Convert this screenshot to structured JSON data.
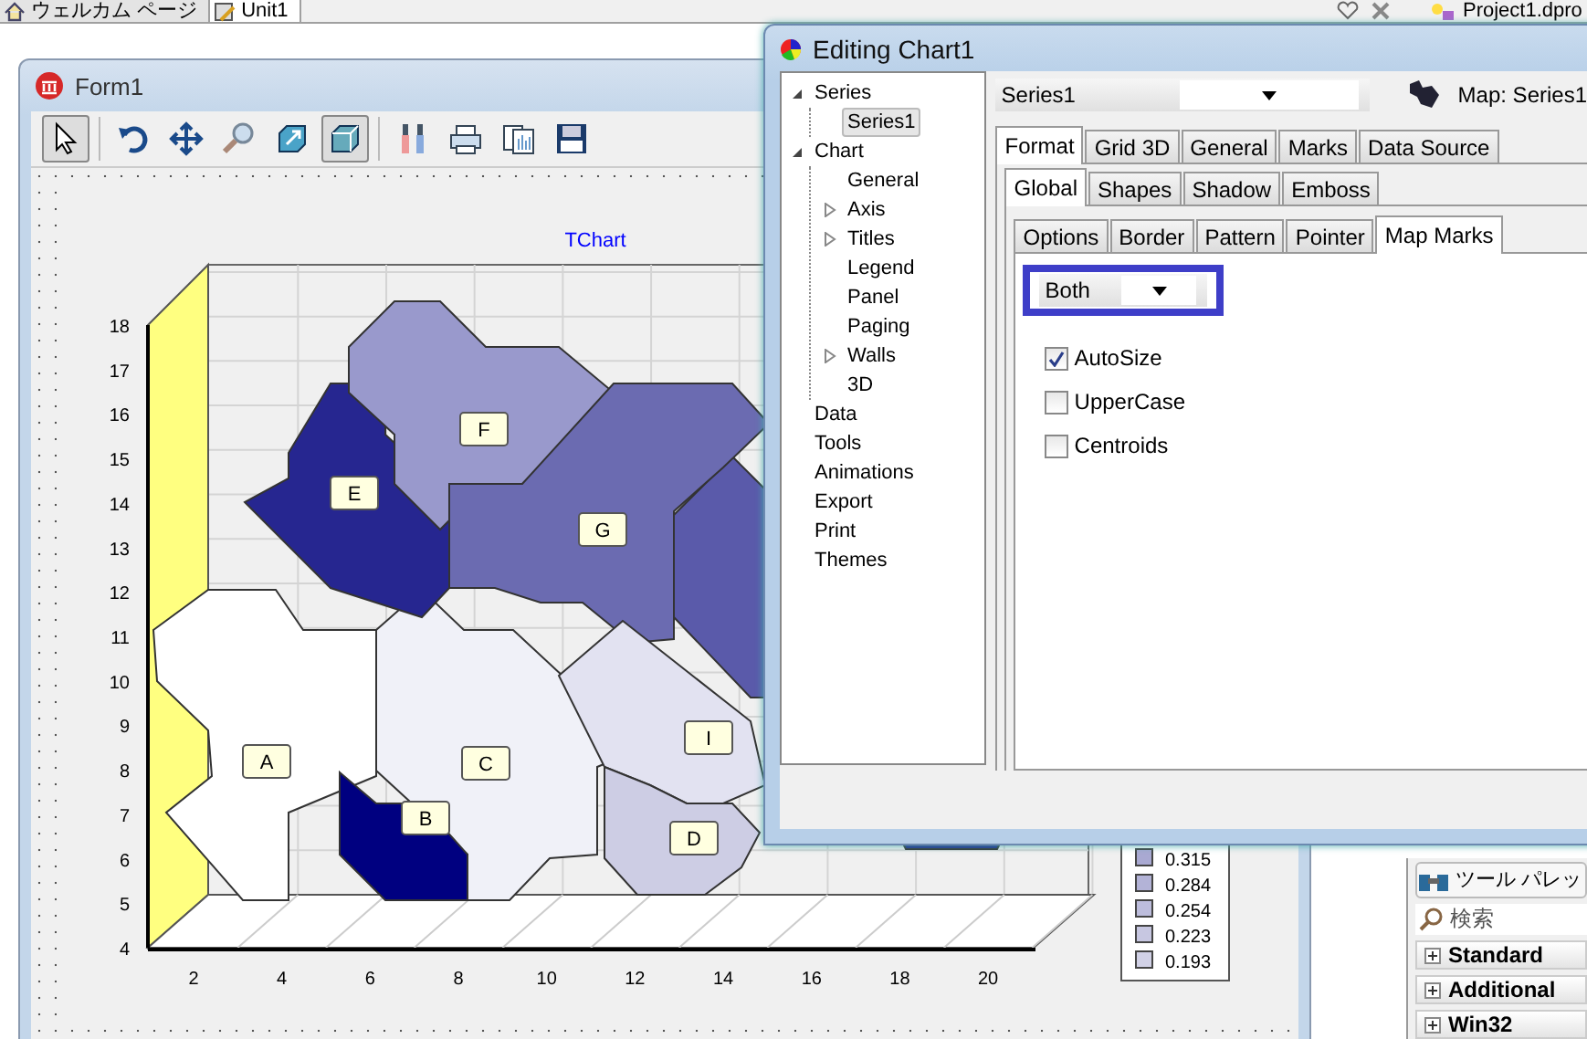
{
  "ide_tabs": [
    {
      "label": "ウェルカム ページ",
      "selected": false
    },
    {
      "label": "Unit1",
      "selected": true
    }
  ],
  "project_tab": {
    "label": "Project1.dpro"
  },
  "form": {
    "title": "Form1",
    "toolbar": [
      {
        "kind": "pointer",
        "selected": true
      },
      {
        "kind": "rotate",
        "selected": false
      },
      {
        "kind": "move",
        "selected": false
      },
      {
        "kind": "zoom",
        "selected": false
      },
      {
        "kind": "depth",
        "selected": false
      },
      {
        "kind": "view3d",
        "selected": true
      },
      {
        "kind": "tools",
        "selected": false
      },
      {
        "kind": "print",
        "selected": false
      },
      {
        "kind": "copy",
        "selected": false
      },
      {
        "kind": "save",
        "selected": false
      }
    ],
    "chart": {
      "title": "TChart",
      "y_labels": [
        "18",
        "17",
        "16",
        "15",
        "14",
        "13",
        "12",
        "11",
        "10",
        "9",
        "8",
        "7",
        "6",
        "5",
        "4"
      ],
      "x_labels": [
        "2",
        "4",
        "6",
        "8",
        "10",
        "12",
        "14",
        "16",
        "18",
        "20"
      ],
      "regions": [
        {
          "label": "A",
          "color": "#ffffff"
        },
        {
          "label": "C",
          "color": "#f0f1f8"
        },
        {
          "label": "B",
          "color": "#000080"
        },
        {
          "label": "E",
          "color": "#262690"
        },
        {
          "label": "F",
          "color": "#9999cc"
        },
        {
          "label": "G",
          "color": "#6b6bb1"
        },
        {
          "label": "I",
          "color": "#e2e2f1"
        },
        {
          "label": "D",
          "color": "#cdcde4"
        }
      ],
      "legend": [
        {
          "value": "0.315",
          "color": "#a9a9d2"
        },
        {
          "value": "0.284",
          "color": "#b3b3d7"
        },
        {
          "value": "0.254",
          "color": "#bdbddc"
        },
        {
          "value": "0.223",
          "color": "#c7c7e1"
        },
        {
          "value": "0.193",
          "color": "#d1d1e6"
        }
      ]
    }
  },
  "editor": {
    "title": "Editing Chart1",
    "tree": [
      {
        "label": "Series",
        "expanded": true,
        "selected": false,
        "children": [
          {
            "label": "Series1",
            "selected": true
          }
        ]
      },
      {
        "label": "Chart",
        "expanded": true,
        "selected": false,
        "children": [
          {
            "label": "General",
            "selected": false
          },
          {
            "label": "Axis",
            "expanded": false,
            "selected": false
          },
          {
            "label": "Titles",
            "expanded": false,
            "selected": false
          },
          {
            "label": "Legend",
            "selected": false
          },
          {
            "label": "Panel",
            "selected": false
          },
          {
            "label": "Paging",
            "selected": false
          },
          {
            "label": "Walls",
            "expanded": false,
            "selected": false
          },
          {
            "label": "3D",
            "selected": false
          }
        ]
      },
      {
        "label": "Data",
        "selected": false
      },
      {
        "label": "Tools",
        "selected": false
      },
      {
        "label": "Animations",
        "selected": false
      },
      {
        "label": "Export",
        "selected": false
      },
      {
        "label": "Print",
        "selected": false
      },
      {
        "label": "Themes",
        "selected": false
      }
    ],
    "series_combo": {
      "value": "Series1"
    },
    "series_caption": "Map: Series1",
    "tabs": [
      {
        "label": "Format",
        "selected": true
      },
      {
        "label": "Grid 3D",
        "selected": false
      },
      {
        "label": "General",
        "selected": false
      },
      {
        "label": "Marks",
        "selected": false
      },
      {
        "label": "Data Source",
        "selected": false
      }
    ],
    "subtabs": [
      {
        "label": "Global",
        "selected": true
      },
      {
        "label": "Shapes",
        "selected": false
      },
      {
        "label": "Shadow",
        "selected": false
      },
      {
        "label": "Emboss",
        "selected": false
      }
    ],
    "page_tabs": [
      {
        "label": "Options",
        "selected": false
      },
      {
        "label": "Border",
        "selected": false
      },
      {
        "label": "Pattern",
        "selected": false
      },
      {
        "label": "Pointer",
        "selected": false
      },
      {
        "label": "Map Marks",
        "selected": true
      }
    ],
    "marks_combo": {
      "value": "Both"
    },
    "options": [
      {
        "label": "AutoSize",
        "checked": true
      },
      {
        "label": "UpperCase",
        "checked": false
      },
      {
        "label": "Centroids",
        "checked": false
      }
    ]
  },
  "palette": {
    "title": "ツール パレッ",
    "search": {
      "placeholder": "検索"
    },
    "categories": [
      {
        "label": "Standard",
        "expanded": false
      },
      {
        "label": "Additional",
        "expanded": false
      },
      {
        "label": "Win32",
        "expanded": false
      }
    ]
  }
}
